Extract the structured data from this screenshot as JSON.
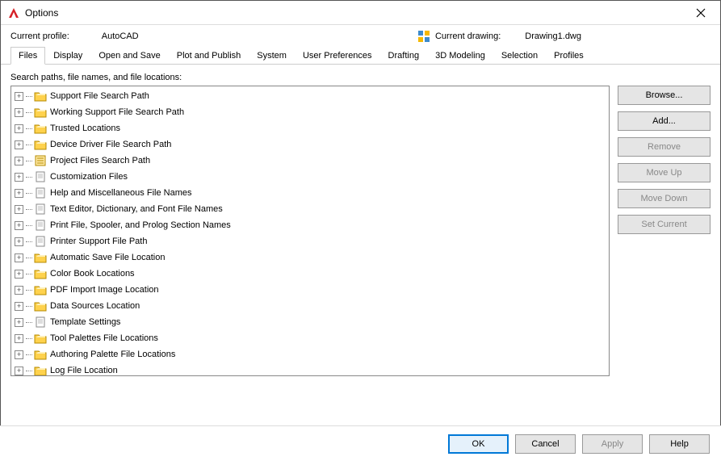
{
  "window": {
    "title": "Options"
  },
  "profile": {
    "label": "Current profile:",
    "value": "AutoCAD"
  },
  "drawing": {
    "label": "Current drawing:",
    "value": "Drawing1.dwg"
  },
  "tabs": [
    {
      "label": "Files",
      "active": true
    },
    {
      "label": "Display"
    },
    {
      "label": "Open and Save"
    },
    {
      "label": "Plot and Publish"
    },
    {
      "label": "System"
    },
    {
      "label": "User Preferences"
    },
    {
      "label": "Drafting"
    },
    {
      "label": "3D Modeling"
    },
    {
      "label": "Selection"
    },
    {
      "label": "Profiles"
    }
  ],
  "section_label": "Search paths, file names, and file locations:",
  "tree": [
    {
      "label": "Support File Search Path",
      "icon": "folder"
    },
    {
      "label": "Working Support File Search Path",
      "icon": "folder"
    },
    {
      "label": "Trusted Locations",
      "icon": "folder"
    },
    {
      "label": "Device Driver File Search Path",
      "icon": "folder"
    },
    {
      "label": "Project Files Search Path",
      "icon": "project"
    },
    {
      "label": "Customization Files",
      "icon": "file"
    },
    {
      "label": "Help and Miscellaneous File Names",
      "icon": "file"
    },
    {
      "label": "Text Editor, Dictionary, and Font File Names",
      "icon": "file"
    },
    {
      "label": "Print File, Spooler, and Prolog Section Names",
      "icon": "file"
    },
    {
      "label": "Printer Support File Path",
      "icon": "file"
    },
    {
      "label": "Automatic Save File Location",
      "icon": "folder"
    },
    {
      "label": "Color Book Locations",
      "icon": "folder"
    },
    {
      "label": "PDF Import Image Location",
      "icon": "folder"
    },
    {
      "label": "Data Sources Location",
      "icon": "folder"
    },
    {
      "label": "Template Settings",
      "icon": "file"
    },
    {
      "label": "Tool Palettes File Locations",
      "icon": "folder"
    },
    {
      "label": "Authoring Palette File Locations",
      "icon": "folder"
    },
    {
      "label": "Log File Location",
      "icon": "folder"
    }
  ],
  "side_buttons": [
    {
      "label": "Browse...",
      "enabled": true
    },
    {
      "label": "Add...",
      "enabled": true
    },
    {
      "label": "Remove",
      "enabled": false
    },
    {
      "label": "Move Up",
      "enabled": false
    },
    {
      "label": "Move Down",
      "enabled": false
    },
    {
      "label": "Set Current",
      "enabled": false
    }
  ],
  "bottom_buttons": {
    "ok": "OK",
    "cancel": "Cancel",
    "apply": "Apply",
    "help": "Help"
  }
}
